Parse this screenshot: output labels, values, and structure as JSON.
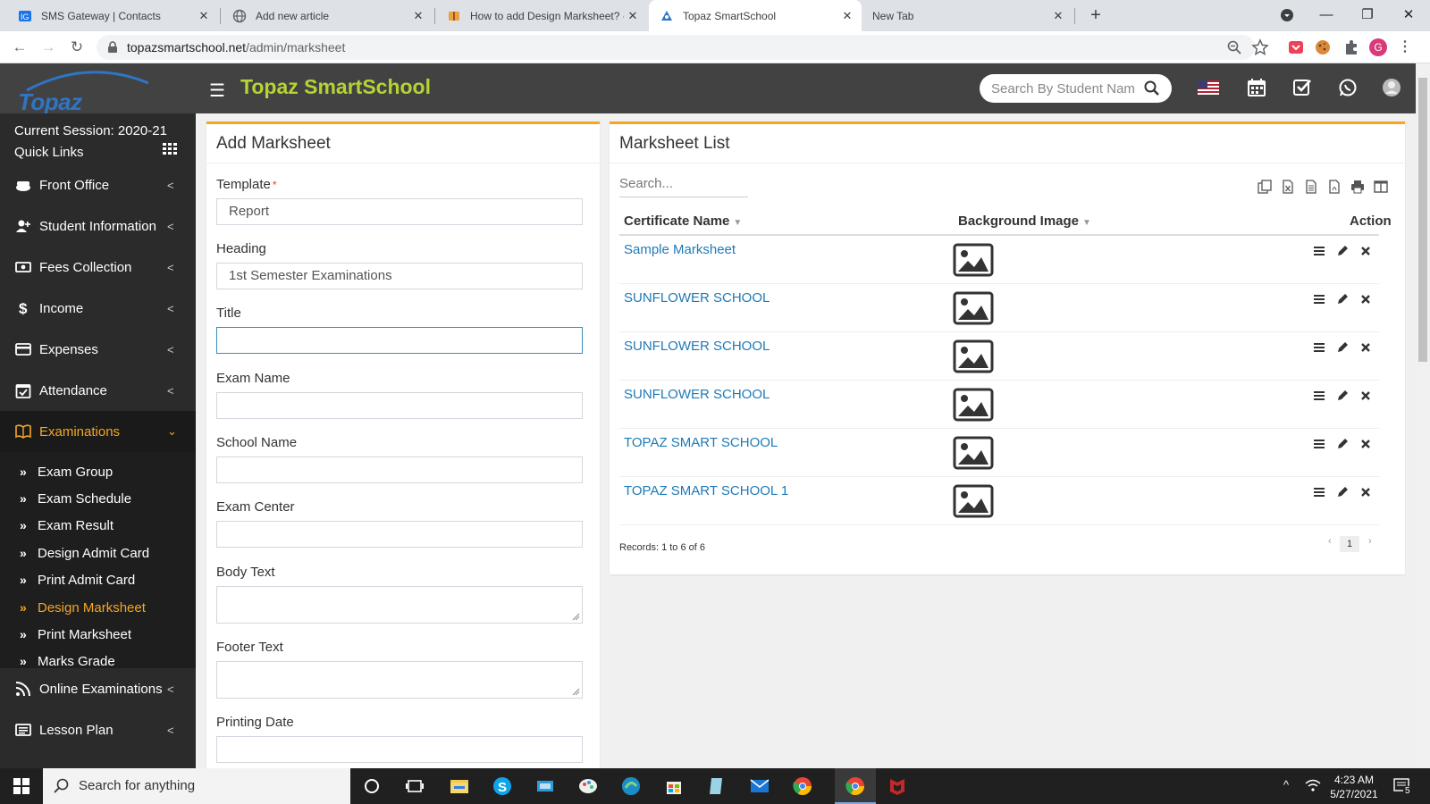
{
  "browser": {
    "tabs": [
      {
        "title": "SMS Gateway | Contacts",
        "active": false
      },
      {
        "title": "Add new article",
        "active": false
      },
      {
        "title": "How to add Design Marksheet? -",
        "active": false
      },
      {
        "title": "Topaz SmartSchool",
        "active": true
      },
      {
        "title": "New Tab",
        "active": false
      }
    ],
    "url_host": "topazsmartschool.net",
    "url_path": "/admin/marksheet",
    "profile_letter": "G"
  },
  "app": {
    "logo_text": "Topaz SmartSchool",
    "brand": "Topaz SmartSchool",
    "search_placeholder": "Search By Student Name",
    "accent": "#f5a623",
    "brand_color": "#b5d334"
  },
  "sidebar": {
    "session": "Current Session: 2020-21",
    "quick_links": "Quick Links",
    "menu": [
      {
        "label": "Front Office",
        "icon": "desk-icon"
      },
      {
        "label": "Student Information",
        "icon": "user-plus-icon"
      },
      {
        "label": "Fees Collection",
        "icon": "money-icon"
      },
      {
        "label": "Income",
        "icon": "dollar-icon"
      },
      {
        "label": "Expenses",
        "icon": "credit-card-icon"
      },
      {
        "label": "Attendance",
        "icon": "calendar-check-icon"
      },
      {
        "label": "Examinations",
        "icon": "book-icon"
      }
    ],
    "submenu": [
      "Exam Group",
      "Exam Schedule",
      "Exam Result",
      "Design Admit Card",
      "Print Admit Card",
      "Design Marksheet",
      "Print Marksheet",
      "Marks Grade"
    ],
    "menu_after": [
      {
        "label": "Online Examinations",
        "icon": "rss-icon"
      },
      {
        "label": "Lesson Plan",
        "icon": "list-icon"
      }
    ]
  },
  "add_form": {
    "title": "Add Marksheet",
    "fields": [
      {
        "label": "Template",
        "required": true,
        "value": "Report",
        "type": "input"
      },
      {
        "label": "Heading",
        "required": false,
        "value": "1st Semester Examinations",
        "type": "input"
      },
      {
        "label": "Title",
        "required": false,
        "value": "",
        "type": "input"
      },
      {
        "label": "Exam Name",
        "required": false,
        "value": "",
        "type": "input"
      },
      {
        "label": "School Name",
        "required": false,
        "value": "",
        "type": "input"
      },
      {
        "label": "Exam Center",
        "required": false,
        "value": "",
        "type": "input"
      },
      {
        "label": "Body Text",
        "required": false,
        "value": "",
        "type": "textarea"
      },
      {
        "label": "Footer Text",
        "required": false,
        "value": "",
        "type": "textarea"
      },
      {
        "label": "Printing Date",
        "required": false,
        "value": "",
        "type": "input"
      }
    ],
    "required_mark": "*"
  },
  "list": {
    "title": "Marksheet List",
    "search_placeholder": "Search...",
    "col_name": "Certificate Name",
    "col_bg": "Background Image",
    "col_action": "Action",
    "rows": [
      "Sample Marksheet",
      "SUNFLOWER SCHOOL",
      "SUNFLOWER SCHOOL",
      "SUNFLOWER SCHOOL",
      "TOPAZ SMART SCHOOL",
      "TOPAZ SMART SCHOOL 1"
    ],
    "records": "Records: 1 to 6 of 6",
    "page": "1",
    "prev": "‹",
    "next": "›"
  },
  "taskbar": {
    "search_text": "Search for anything",
    "time": "4:23 AM",
    "date": "5/27/2021",
    "notif_count": "5"
  }
}
